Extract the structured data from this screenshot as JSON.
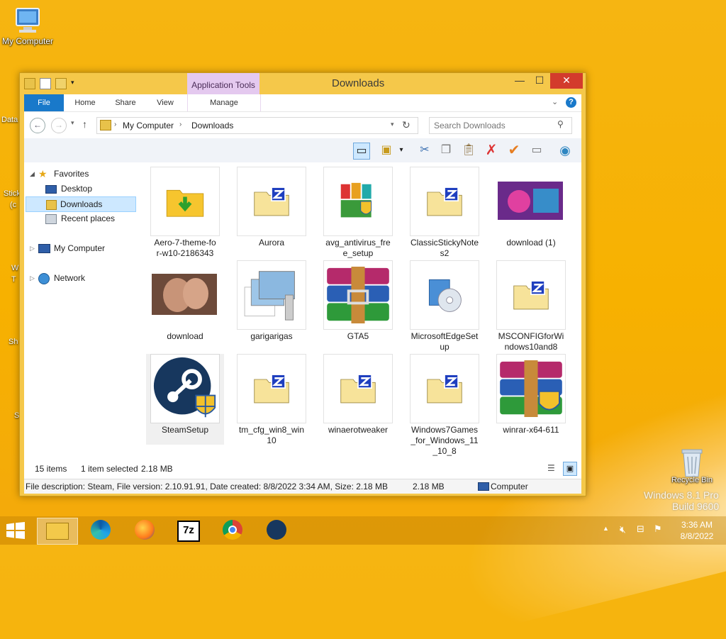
{
  "desktop": {
    "icons": [
      {
        "label": "My Computer"
      },
      {
        "label": "Recycle Bin"
      }
    ],
    "partial_labels": [
      "Data",
      "Stick",
      "(c",
      "W",
      "T",
      "Sh",
      "S"
    ]
  },
  "window": {
    "title": "Downloads",
    "context_tab_group": "Application Tools",
    "ribbon_tabs": [
      {
        "label": "File"
      },
      {
        "label": "Home"
      },
      {
        "label": "Share"
      },
      {
        "label": "View"
      },
      {
        "label": "Manage"
      }
    ],
    "address": {
      "segments": [
        "My Computer",
        "Downloads"
      ]
    },
    "search": {
      "placeholder": "Search Downloads"
    },
    "nav_tree": [
      {
        "label": "Favorites",
        "level": 0,
        "icon": "star-icon"
      },
      {
        "label": "Desktop",
        "level": 1,
        "icon": "desktop-icon"
      },
      {
        "label": "Downloads",
        "level": 1,
        "icon": "downloads-folder-icon",
        "selected": true
      },
      {
        "label": "Recent places",
        "level": 1,
        "icon": "recent-places-icon"
      },
      {
        "label": "My Computer",
        "level": 0,
        "icon": "computer-icon"
      },
      {
        "label": "Network",
        "level": 0,
        "icon": "network-icon"
      }
    ],
    "files": [
      {
        "name": "Aero-7-theme-fo\nr-w10-2186343",
        "icon": "folder-download-icon"
      },
      {
        "name": "Aurora",
        "icon": "zip-folder-icon"
      },
      {
        "name": "avg_antivirus_fre\ne_setup",
        "icon": "avg-icon"
      },
      {
        "name": "ClassicStickyNote\ns2",
        "icon": "zip-folder-icon"
      },
      {
        "name": "download (1)",
        "icon": "image-thumbnail-icon"
      },
      {
        "name": "download",
        "icon": "image-thumbnail-icon"
      },
      {
        "name": "garigarigas",
        "icon": "image-stack-zip-icon"
      },
      {
        "name": "GTA5",
        "icon": "winrar-icon"
      },
      {
        "name": "MicrosoftEdgeSet\nup",
        "icon": "installer-cd-icon"
      },
      {
        "name": "MSCONFIGforWi\nndows10and8",
        "icon": "zip-folder-icon"
      },
      {
        "name": "SteamSetup",
        "icon": "steam-shield-icon",
        "selected": true
      },
      {
        "name": "tm_cfg_win8_win\n10",
        "icon": "zip-folder-icon"
      },
      {
        "name": "winaerotweaker",
        "icon": "zip-folder-icon"
      },
      {
        "name": "Windows7Games\n_for_Windows_11\n_10_8",
        "icon": "zip-folder-icon"
      },
      {
        "name": "winrar-x64-611",
        "icon": "winrar-shield-icon"
      }
    ],
    "status": {
      "item_count": "15 items",
      "selection": "1 item selected",
      "size": "2.18 MB"
    },
    "details_bar": {
      "description": "File description: Steam, File version: 2.10.91.91, Date created: 8/8/2022 3:34 AM, Size: 2.18 MB",
      "size": "2.18 MB",
      "location": "Computer"
    }
  },
  "taskbar": {
    "apps": [
      {
        "icon": "file-explorer-icon",
        "active": true
      },
      {
        "icon": "edge-icon"
      },
      {
        "icon": "firefox-icon"
      },
      {
        "icon": "7zip-icon",
        "label": "7z"
      },
      {
        "icon": "chrome-icon"
      },
      {
        "icon": "steam-icon"
      }
    ],
    "clock": {
      "time": "3:36 AM",
      "date": "8/8/2022"
    }
  },
  "watermark": {
    "line1": "Windows 8.1 Pro",
    "line2": "Build 9600"
  },
  "colors": {
    "accent": "#1979ca",
    "desktop": "#f6b512",
    "selection": "#cde8ff",
    "close": "#d33b2c"
  }
}
